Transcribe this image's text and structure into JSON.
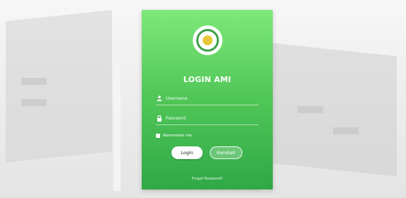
{
  "login_card": {
    "title": "LOGIN AMI",
    "username_placeholder": "Username",
    "password_placeholder": "Password",
    "remember_label": "Remember me",
    "login_button": "Login",
    "back_button": "Kembali",
    "forgot_link": "Forgot Password?"
  },
  "icons": {
    "username": "user-icon",
    "password": "lock-icon",
    "logo": "university-seal-logo"
  },
  "colors": {
    "card_top": "#7ee87a",
    "card_bottom": "#2fa846",
    "text": "#ffffff"
  }
}
